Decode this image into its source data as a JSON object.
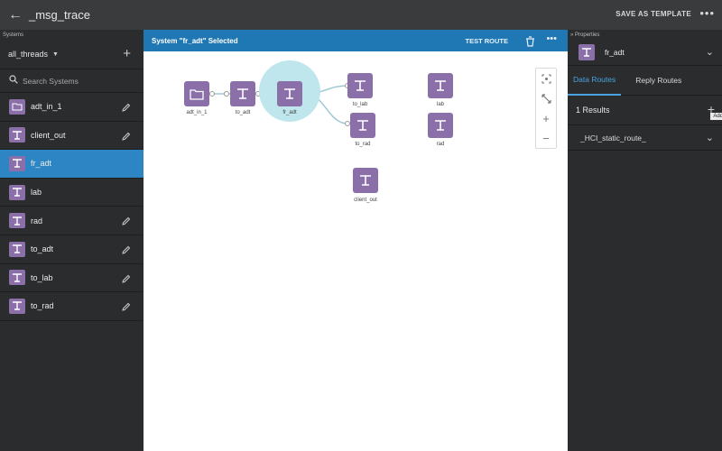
{
  "topbar": {
    "title": "_msg_trace",
    "save_template": "SAVE AS TEMPLATE",
    "more": "•••"
  },
  "left": {
    "section_label": "Systems",
    "filter_value": "all_threads",
    "search_placeholder": "Search Systems",
    "items": [
      {
        "label": "adt_in_1",
        "type": "folder"
      },
      {
        "label": "client_out"
      },
      {
        "label": "fr_adt"
      },
      {
        "label": "lab"
      },
      {
        "label": "rad"
      },
      {
        "label": "to_adt"
      },
      {
        "label": "to_lab"
      },
      {
        "label": "to_rad"
      }
    ]
  },
  "canvas": {
    "header_title": "System \"fr_adt\" Selected",
    "test_route": "TEST ROUTE",
    "nodes": [
      {
        "label": "adt_in_1"
      },
      {
        "label": "to_adt"
      },
      {
        "label": "fr_adt"
      },
      {
        "label": "to_lab"
      },
      {
        "label": "to_rad"
      },
      {
        "label": "lab"
      },
      {
        "label": "rad"
      },
      {
        "label": "client_out"
      }
    ]
  },
  "right": {
    "section_label": "Properties",
    "selected_name": "fr_adt",
    "tabs": [
      "Data Routes",
      "Reply Routes"
    ],
    "results": "1 Results",
    "tooltip": "Add",
    "route": "_HCI_static_route_"
  },
  "colors": {
    "accent": "#1f78b4",
    "icon": "#8a6fa8",
    "selected_row": "#2d85c4",
    "halo": "#bfe6ec"
  }
}
